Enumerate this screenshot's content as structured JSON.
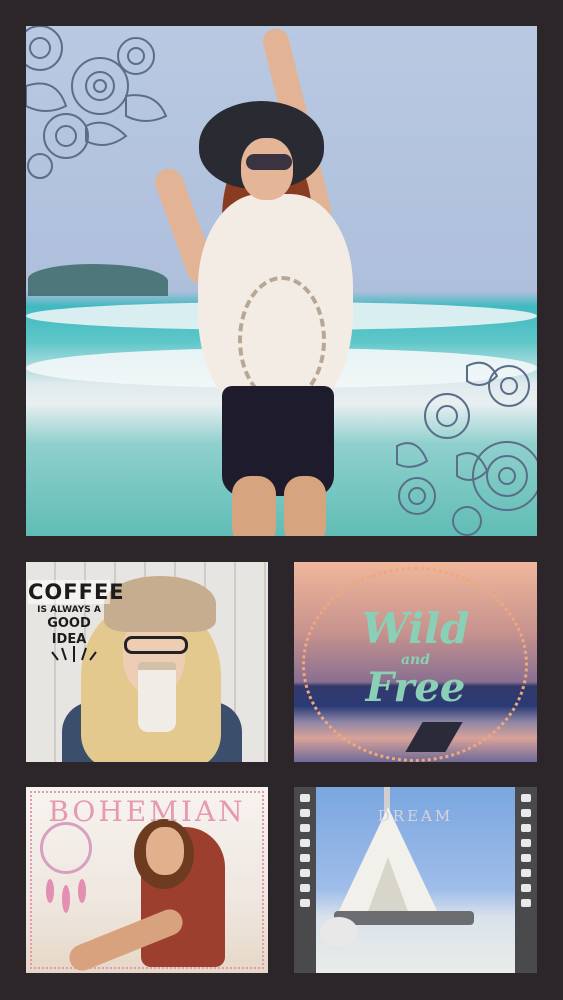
{
  "collage": {
    "background_color": "#2c2529",
    "tiles": [
      {
        "id": "beach",
        "description_icon": "photo-icon"
      },
      {
        "id": "coffee",
        "texts": [
          "COFFEE",
          "IS ALWAYS A",
          "GOOD IDEA"
        ]
      },
      {
        "id": "wild",
        "texts": [
          "Wild",
          "and",
          "Free"
        ]
      },
      {
        "id": "bohemian",
        "texts": [
          "BOHEMIAN"
        ]
      },
      {
        "id": "teepee",
        "texts": [
          "DREAM"
        ]
      }
    ]
  }
}
